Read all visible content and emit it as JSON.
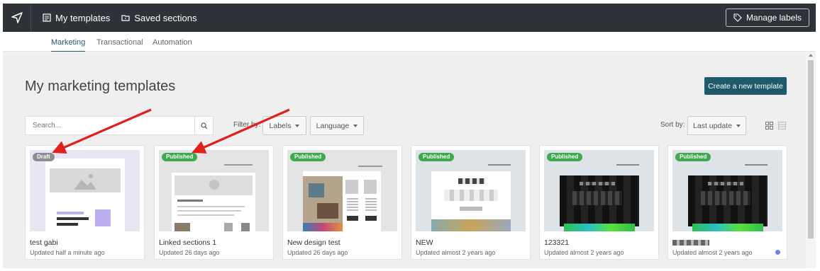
{
  "topbar": {
    "nav": [
      {
        "label": "My templates",
        "icon": "template-icon"
      },
      {
        "label": "Saved sections",
        "icon": "saved-sections-icon"
      }
    ],
    "manage_labels": "Manage labels"
  },
  "tabs": [
    {
      "label": "Marketing",
      "active": true
    },
    {
      "label": "Transactional",
      "active": false
    },
    {
      "label": "Automation",
      "active": false
    }
  ],
  "page": {
    "title": "My marketing templates",
    "create_button": "Create a new template"
  },
  "filters": {
    "search_placeholder": "Search...",
    "filter_label": "Filter by:",
    "labels_dropdown": "Labels",
    "language_dropdown": "Language",
    "sort_label": "Sort by:",
    "sort_value": "Last update"
  },
  "templates": [
    {
      "name": "test gabi",
      "updated": "Updated half a minute ago",
      "status": "Draft"
    },
    {
      "name": "Linked sections 1",
      "updated": "Updated 26 days ago",
      "status": "Published"
    },
    {
      "name": "New design test",
      "updated": "Updated 26 days ago",
      "status": "Published"
    },
    {
      "name": "NEW",
      "updated": "Updated almost 2 years ago",
      "status": "Published"
    },
    {
      "name": "123321",
      "updated": "Updated almost 2 years ago",
      "status": "Published"
    },
    {
      "name": "",
      "updated": "Updated almost 2 years ago",
      "status": "Published"
    }
  ],
  "colors": {
    "topbar": "#2f3238",
    "accent": "#1f5a6b",
    "published": "#3ea94f",
    "draft": "#8a8d92",
    "annotation_arrow": "#e0201b",
    "dot": "#6b86e6"
  }
}
